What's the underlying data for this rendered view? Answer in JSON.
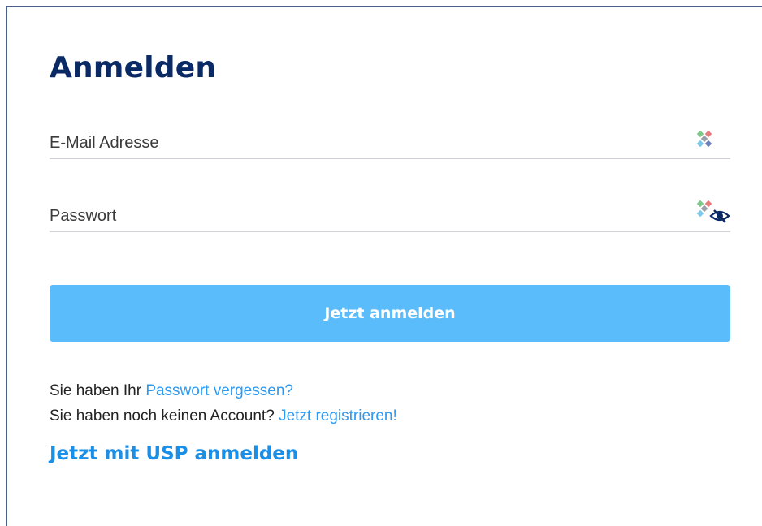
{
  "form": {
    "title": "Anmelden",
    "email": {
      "placeholder": "E-Mail Adresse",
      "value": ""
    },
    "password": {
      "placeholder": "Passwort",
      "value": ""
    },
    "submit_label": "Jetzt anmelden"
  },
  "help": {
    "forgot_prefix": "Sie haben Ihr ",
    "forgot_link": "Passwort vergessen?",
    "register_prefix": "Sie haben noch keinen Account? ",
    "register_link": "Jetzt registrieren!"
  },
  "usp_login_link": "Jetzt mit USP anmelden",
  "colors": {
    "title": "#0a2a66",
    "button": "#5bbcfb",
    "link": "#2b9af3",
    "usp_link": "#1a8fe8"
  },
  "icons": {
    "password_manager": "password-manager-icon",
    "show_password": "eye-icon"
  }
}
